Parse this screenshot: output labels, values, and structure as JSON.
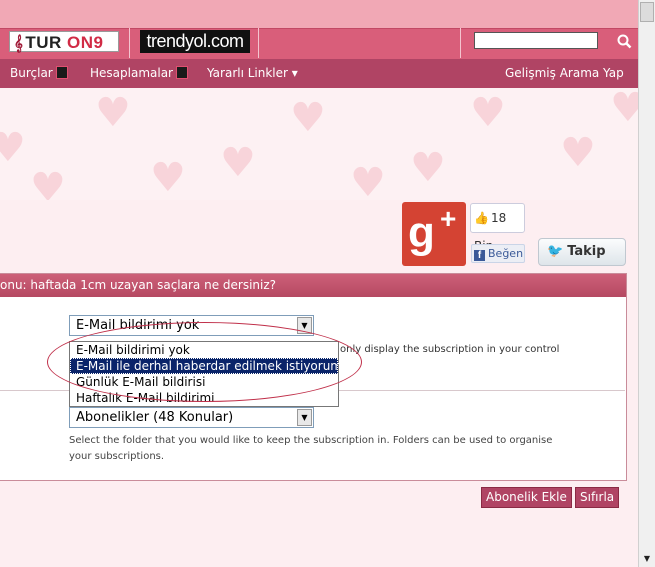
{
  "header": {
    "logo1_prefix": "TUR ",
    "logo1_accent": "ON9",
    "logo2": "trendyol.com",
    "search": {
      "value": "",
      "placeholder": ""
    }
  },
  "nav": {
    "items": [
      "Burçlar",
      "Hesaplamalar",
      "Yararlı Linkler"
    ],
    "right": "Gelişmiş Arama Yap"
  },
  "social": {
    "like_count": "18 Bin",
    "like_label": "Beğen",
    "follow_label": "Takip"
  },
  "panel": {
    "title": "onu: haftada 1cm uzayan saçlara ne dersiniz?",
    "notification": {
      "selected": "E-Mail bildirimi yok",
      "options": [
        "E-Mail bildirimi yok",
        "E-Mail ile derhal haberdar edilmek istiyorum",
        "Günlük E-Mail bildirisi",
        "Haftalık E-Mail bildirimi"
      ],
      "highlighted_index": 1,
      "hint": "only display the subscription in your control"
    },
    "folder": {
      "selected": "Abonelikler (48 Konular)",
      "hint": "Select the folder that you would like to keep the subscription in. Folders can be used to organise your subscriptions."
    }
  },
  "actions": {
    "add": "Abonelik Ekle",
    "reset": "Sıfırla"
  },
  "colors": {
    "header": "#d95e7a",
    "nav": "#b04464",
    "selection": "#0a246a",
    "annotation": "#c0304a"
  }
}
